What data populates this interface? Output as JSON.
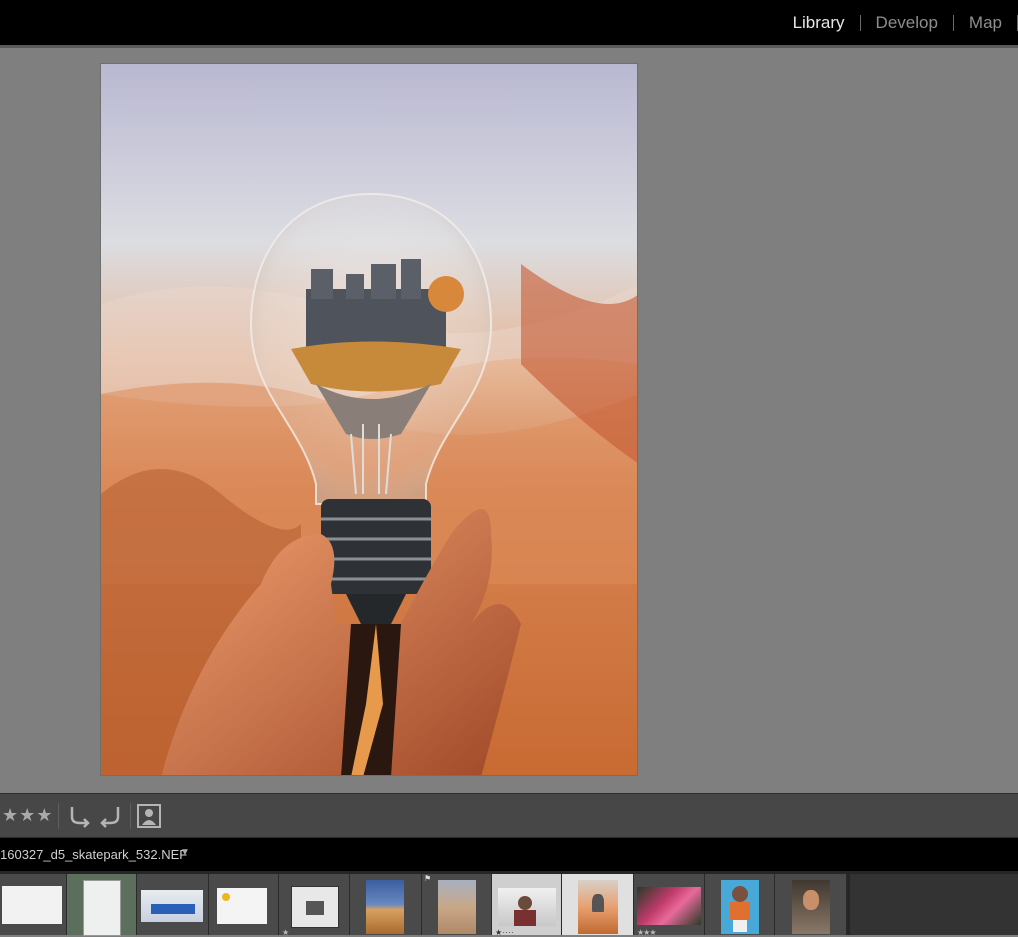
{
  "modules": {
    "library": "Library",
    "develop": "Develop",
    "map": "Map"
  },
  "toolbar": {
    "rating": "★★★"
  },
  "filmstrip": {
    "current_file": "160327_d5_skatepark_532.NEF",
    "cell_stars": [
      "★",
      "★ · · · ·",
      "★★★"
    ]
  },
  "colors": {
    "topbar": "#000000",
    "active_module": "#e6e6e6",
    "inactive_module": "#8e8e8e",
    "background": "#7f7f7f"
  }
}
